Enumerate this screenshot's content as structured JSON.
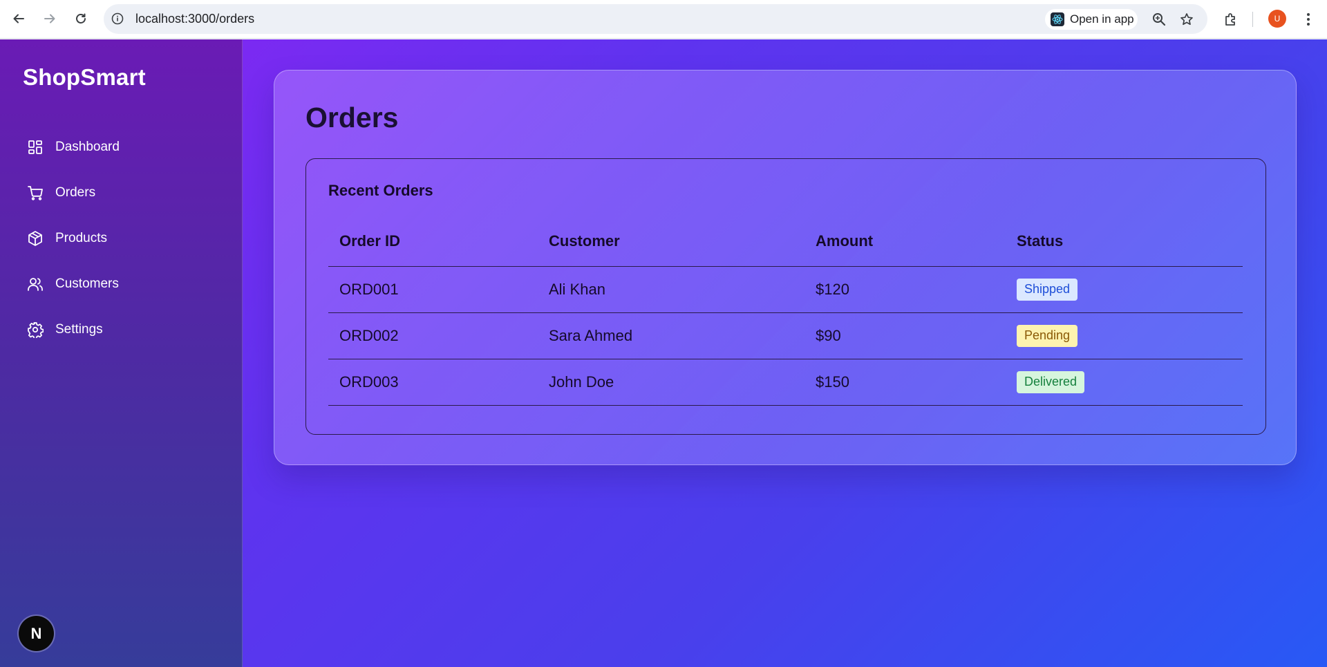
{
  "browser": {
    "url": "localhost:3000/orders",
    "open_in_app": "Open in app",
    "profile_initial": "U"
  },
  "sidebar": {
    "brand": "ShopSmart",
    "items": [
      {
        "label": "Dashboard",
        "icon": "dashboard-icon"
      },
      {
        "label": "Orders",
        "icon": "cart-icon"
      },
      {
        "label": "Products",
        "icon": "box-icon"
      },
      {
        "label": "Customers",
        "icon": "users-icon"
      },
      {
        "label": "Settings",
        "icon": "gear-icon"
      }
    ],
    "dev_badge": "N"
  },
  "main": {
    "title": "Orders",
    "section_title": "Recent Orders",
    "columns": [
      "Order ID",
      "Customer",
      "Amount",
      "Status"
    ],
    "rows": [
      {
        "id": "ORD001",
        "customer": "Ali Khan",
        "amount": "$120",
        "status": "Shipped",
        "status_color": "#1e4ed8"
      },
      {
        "id": "ORD002",
        "customer": "Sara Ahmed",
        "amount": "$90",
        "status": "Pending",
        "status_color": "#8a5a06"
      },
      {
        "id": "ORD003",
        "customer": "John Doe",
        "amount": "$150",
        "status": "Delivered",
        "status_color": "#15803d"
      }
    ]
  },
  "colors": {
    "gradient_start": "#8b25f3",
    "gradient_end": "#2859f5",
    "sidebar_top": "#6a1bb5"
  }
}
